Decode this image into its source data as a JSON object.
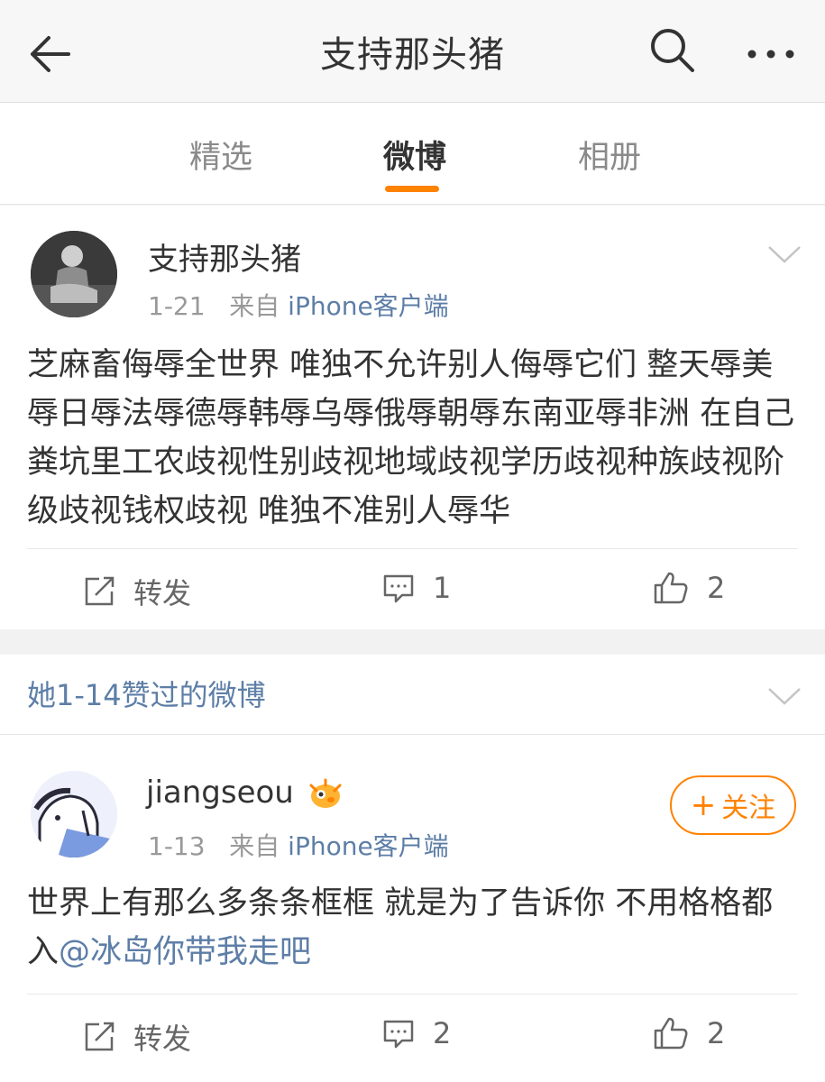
{
  "header": {
    "title": "支持那头猪"
  },
  "tabs": [
    {
      "label": "精选",
      "active": false
    },
    {
      "label": "微博",
      "active": true
    },
    {
      "label": "相册",
      "active": false
    }
  ],
  "accent_color": "#ff8200",
  "link_color": "#5d7ea7",
  "posts": [
    {
      "author": "支持那头猪",
      "date": "1-21",
      "from": "来自",
      "source": "iPhone客户端",
      "text": "芝麻畜侮辱全世界 唯独不允许别人侮辱它们 整天辱美辱日辱法辱德辱韩辱乌辱俄辱朝辱东南亚辱非洲 在自己粪坑里工农歧视性别歧视地域歧视学历歧视种族歧视阶级歧视钱权歧视 唯独不准别人辱华",
      "actions": {
        "repost": "转发",
        "comments": "1",
        "likes": "2"
      }
    },
    {
      "author": "jiangseou",
      "date": "1-13",
      "from": "来自",
      "source": "iPhone客户端",
      "text": "世界上有那么多条条框框 就是为了告诉你 不用格格都入",
      "mention": "@冰岛你带我走吧",
      "follow_label": "关注",
      "follow_plus": "+",
      "actions": {
        "repost": "转发",
        "comments": "2",
        "likes": "2"
      }
    }
  ],
  "liked_section": {
    "label": "她1-14赞过的微博"
  },
  "icons": [
    "back-arrow-icon",
    "search-icon",
    "more-icon",
    "chevron-down-icon",
    "repost-icon",
    "comment-icon",
    "like-icon",
    "badge-icon"
  ]
}
